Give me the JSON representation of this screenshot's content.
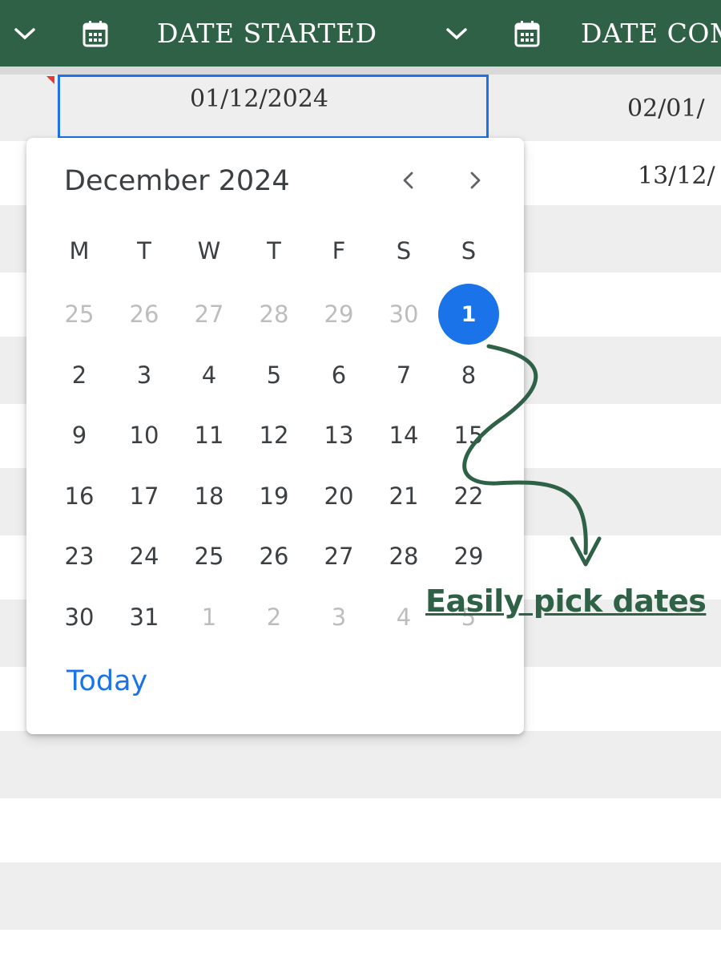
{
  "header": {
    "col1_title": "DATE STARTED",
    "col2_title": "DATE COM",
    "icons": [
      "chevron-down-icon",
      "calendar-icon"
    ]
  },
  "sheet": {
    "selected_cell_value": "01/12/2024",
    "right_col_values": [
      "02/01/",
      "13/12/"
    ]
  },
  "datepicker": {
    "month_label": "December 2024",
    "weekdays": [
      "M",
      "T",
      "W",
      "T",
      "F",
      "S",
      "S"
    ],
    "weeks": [
      [
        {
          "d": "25",
          "o": true
        },
        {
          "d": "26",
          "o": true
        },
        {
          "d": "27",
          "o": true
        },
        {
          "d": "28",
          "o": true
        },
        {
          "d": "29",
          "o": true
        },
        {
          "d": "30",
          "o": true
        },
        {
          "d": "1",
          "sel": true
        }
      ],
      [
        {
          "d": "2"
        },
        {
          "d": "3"
        },
        {
          "d": "4"
        },
        {
          "d": "5"
        },
        {
          "d": "6"
        },
        {
          "d": "7"
        },
        {
          "d": "8"
        }
      ],
      [
        {
          "d": "9"
        },
        {
          "d": "10"
        },
        {
          "d": "11"
        },
        {
          "d": "12"
        },
        {
          "d": "13"
        },
        {
          "d": "14"
        },
        {
          "d": "15"
        }
      ],
      [
        {
          "d": "16"
        },
        {
          "d": "17"
        },
        {
          "d": "18"
        },
        {
          "d": "19"
        },
        {
          "d": "20"
        },
        {
          "d": "21"
        },
        {
          "d": "22"
        }
      ],
      [
        {
          "d": "23"
        },
        {
          "d": "24"
        },
        {
          "d": "25"
        },
        {
          "d": "26"
        },
        {
          "d": "27"
        },
        {
          "d": "28"
        },
        {
          "d": "29"
        }
      ],
      [
        {
          "d": "30"
        },
        {
          "d": "31"
        },
        {
          "d": "1",
          "o": true
        },
        {
          "d": "2",
          "o": true
        },
        {
          "d": "3",
          "o": true
        },
        {
          "d": "4",
          "o": true
        },
        {
          "d": "5",
          "o": true
        }
      ]
    ],
    "today_label": "Today"
  },
  "annotation": {
    "text": "Easily pick dates"
  },
  "colors": {
    "header_bg": "#2f6147",
    "accent_blue": "#1a73e8",
    "annotation_green": "#2f6147",
    "row_shade": "#eeeeee"
  }
}
